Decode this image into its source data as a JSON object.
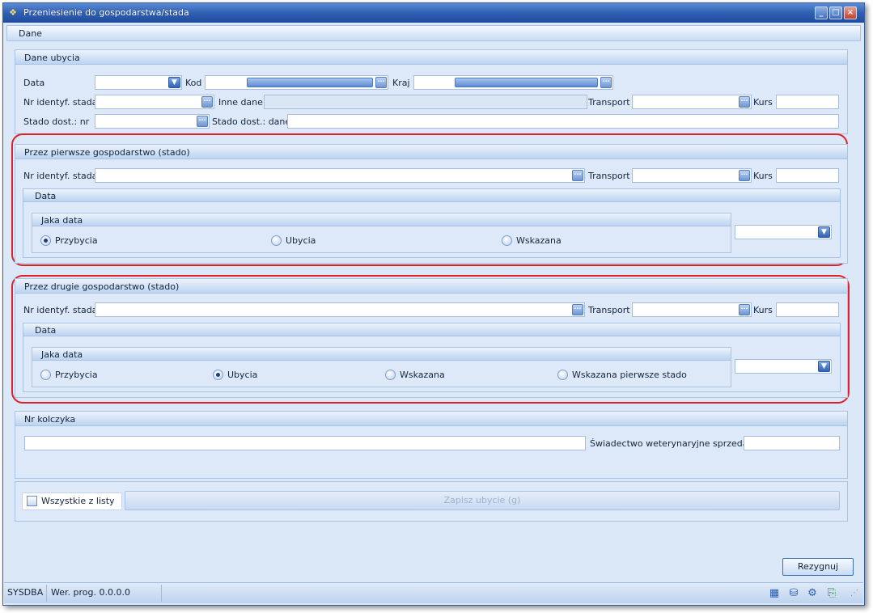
{
  "window": {
    "title": "Przeniesienie do gospodarstwa/stada"
  },
  "tab": {
    "label": "Dane"
  },
  "dane_ubycia": {
    "title": "Dane ubycia",
    "data_label": "Data",
    "data_value": "",
    "kod_label": "Kod",
    "kraj_label": "Kraj",
    "nr_label": "Nr identyf. stada",
    "inne_label": "Inne dane",
    "transport_label": "Transport",
    "kurs_label": "Kurs",
    "stado_nr_label": "Stado dost.: nr",
    "stado_dane_label": "Stado dost.: dane"
  },
  "pierwsze": {
    "title": "Przez pierwsze gospodarstwo (stado)",
    "nr_label": "Nr identyf. stada",
    "transport_label": "Transport",
    "kurs_label": "Kurs",
    "data_title": "Data",
    "jaka_title": "Jaka data",
    "options": [
      "Przybycia",
      "Ubycia",
      "Wskazana"
    ],
    "selected": "Przybycia"
  },
  "drugie": {
    "title": "Przez drugie gospodarstwo (stado)",
    "nr_label": "Nr identyf. stada",
    "transport_label": "Transport",
    "kurs_label": "Kurs",
    "data_title": "Data",
    "jaka_title": "Jaka data",
    "options": [
      "Przybycia",
      "Ubycia",
      "Wskazana",
      "Wskazana pierwsze stado"
    ],
    "selected": "Ubycia"
  },
  "kolczyk": {
    "title": "Nr kolczyka",
    "swiadectwo_label": "Świadectwo weterynaryjne sprzedaży"
  },
  "actions": {
    "wszystkie_label": "Wszystkie z listy",
    "zapisz_label": "Zapisz ubycie (g)",
    "rezygnuj_label": "Rezygnuj"
  },
  "status": {
    "user": "SYSDBA",
    "version": "Wer. prog. 0.0.0.0"
  },
  "icons": [
    "calculator-icon",
    "database-icon",
    "gear-icon",
    "export-icon",
    "resize-grip-icon"
  ]
}
